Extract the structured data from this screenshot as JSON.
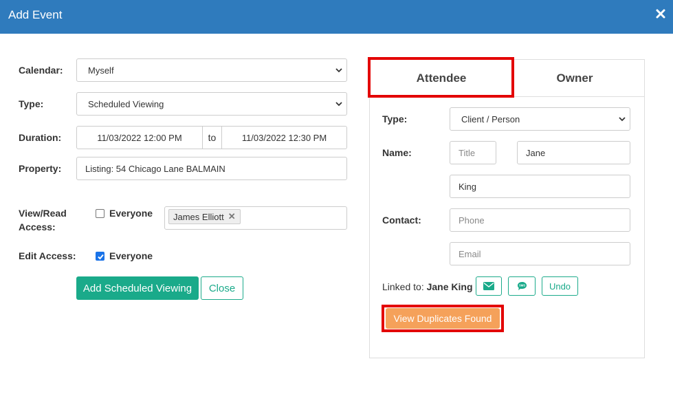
{
  "header": {
    "title": "Add Event"
  },
  "form": {
    "calendar": {
      "label": "Calendar:",
      "value": "Myself"
    },
    "type": {
      "label": "Type:",
      "value": "Scheduled Viewing"
    },
    "duration": {
      "label": "Duration:",
      "start": "11/03/2022 12:00 PM",
      "to": "to",
      "end": "11/03/2022 12:30 PM"
    },
    "property": {
      "label": "Property:",
      "value": "Listing: 54 Chicago Lane BALMAIN"
    },
    "view_access": {
      "label_line1": "View/Read",
      "label_line2": "Access:",
      "everyone_label": "Everyone",
      "everyone_checked": false,
      "tags": [
        "James Elliott"
      ]
    },
    "edit_access": {
      "label": "Edit Access:",
      "everyone_label": "Everyone",
      "everyone_checked": true
    },
    "submit_label": "Add Scheduled Viewing",
    "close_label": "Close"
  },
  "panel": {
    "tabs": [
      {
        "label": "Attendee",
        "active": true
      },
      {
        "label": "Owner",
        "active": false
      }
    ],
    "type": {
      "label": "Type:",
      "value": "Client / Person"
    },
    "name": {
      "label": "Name:",
      "title_placeholder": "Title",
      "first": "Jane",
      "last": "King"
    },
    "contact": {
      "label": "Contact:",
      "phone_placeholder": "Phone",
      "email_placeholder": "Email"
    },
    "linked": {
      "prefix": "Linked to:",
      "name": "Jane King",
      "undo_label": "Undo"
    },
    "duplicates_label": "View Duplicates Found"
  },
  "colors": {
    "header": "#2f7bbd",
    "accent": "#1aaa8a",
    "warning": "#f5a15a",
    "highlight": "#e30000"
  }
}
